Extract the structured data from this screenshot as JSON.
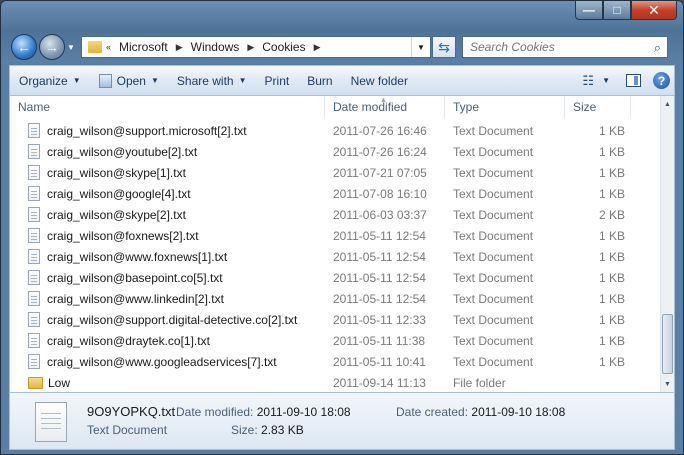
{
  "window": {
    "caption_buttons": {
      "minimize": "—",
      "maximize": "□",
      "close": "✕"
    }
  },
  "nav": {
    "breadcrumb_prefix": "«",
    "breadcrumb": [
      "Microsoft",
      "Windows",
      "Cookies"
    ],
    "search_placeholder": "Search Cookies"
  },
  "toolbar": {
    "organize": "Organize",
    "open": "Open",
    "share_with": "Share with",
    "print": "Print",
    "burn": "Burn",
    "new_folder": "New folder"
  },
  "columns": {
    "name": "Name",
    "date_modified": "Date modified",
    "type": "Type",
    "size": "Size"
  },
  "files": [
    {
      "name": "craig_wilson@support.microsoft[2].txt",
      "date": "2011-07-26 16:46",
      "type": "Text Document",
      "size": "1 KB"
    },
    {
      "name": "craig_wilson@youtube[2].txt",
      "date": "2011-07-26 16:24",
      "type": "Text Document",
      "size": "1 KB"
    },
    {
      "name": "craig_wilson@skype[1].txt",
      "date": "2011-07-21 07:05",
      "type": "Text Document",
      "size": "1 KB"
    },
    {
      "name": "craig_wilson@google[4].txt",
      "date": "2011-07-08 16:10",
      "type": "Text Document",
      "size": "1 KB"
    },
    {
      "name": "craig_wilson@skype[2].txt",
      "date": "2011-06-03 03:37",
      "type": "Text Document",
      "size": "2 KB"
    },
    {
      "name": "craig_wilson@foxnews[2].txt",
      "date": "2011-05-11 12:54",
      "type": "Text Document",
      "size": "1 KB"
    },
    {
      "name": "craig_wilson@www.foxnews[1].txt",
      "date": "2011-05-11 12:54",
      "type": "Text Document",
      "size": "1 KB"
    },
    {
      "name": "craig_wilson@basepoint.co[5].txt",
      "date": "2011-05-11 12:54",
      "type": "Text Document",
      "size": "1 KB"
    },
    {
      "name": "craig_wilson@www.linkedin[2].txt",
      "date": "2011-05-11 12:54",
      "type": "Text Document",
      "size": "1 KB"
    },
    {
      "name": "craig_wilson@support.digital-detective.co[2].txt",
      "date": "2011-05-11 12:33",
      "type": "Text Document",
      "size": "1 KB"
    },
    {
      "name": "craig_wilson@draytek.co[1].txt",
      "date": "2011-05-11 11:38",
      "type": "Text Document",
      "size": "1 KB"
    },
    {
      "name": "craig_wilson@www.googleadservices[7].txt",
      "date": "2011-05-11 10:41",
      "type": "Text Document",
      "size": "1 KB"
    },
    {
      "name": "Low",
      "date": "2011-09-14 11:13",
      "type": "File folder",
      "size": "",
      "is_folder": true
    }
  ],
  "details": {
    "name": "9O9YOPKQ.txt",
    "type": "Text Document",
    "date_modified_label": "Date modified:",
    "date_modified": "2011-09-10 18:08",
    "date_created_label": "Date created:",
    "date_created": "2011-09-10 18:08",
    "size_label": "Size:",
    "size": "2.83 KB"
  }
}
